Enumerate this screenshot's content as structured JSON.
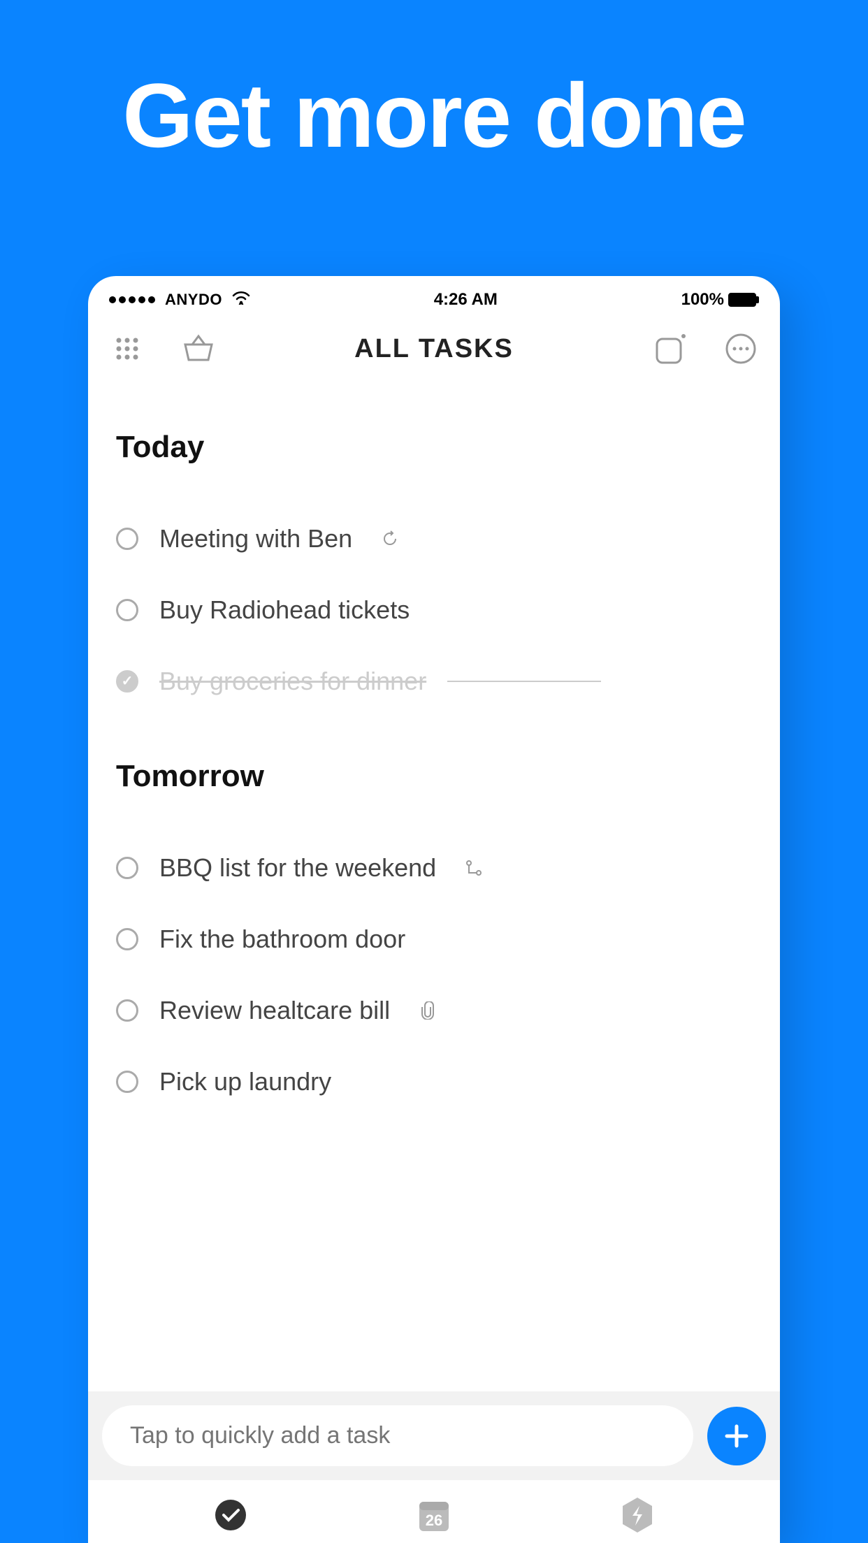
{
  "hero": "Get more done",
  "statusBar": {
    "carrier": "ANYDO",
    "time": "4:26 AM",
    "battery": "100%"
  },
  "nav": {
    "title": "ALL TASKS"
  },
  "sections": [
    {
      "title": "Today",
      "tasks": [
        {
          "label": "Meeting with Ben",
          "done": false,
          "indicator": "recurring"
        },
        {
          "label": "Buy Radiohead tickets",
          "done": false,
          "indicator": null
        },
        {
          "label": "Buy groceries for dinner",
          "done": true,
          "indicator": null
        }
      ]
    },
    {
      "title": "Tomorrow",
      "tasks": [
        {
          "label": "BBQ list for the weekend",
          "done": false,
          "indicator": "subtasks"
        },
        {
          "label": "Fix the bathroom door",
          "done": false,
          "indicator": null
        },
        {
          "label": "Review healtcare bill",
          "done": false,
          "indicator": "attachment"
        },
        {
          "label": "Pick up laundry",
          "done": false,
          "indicator": null
        }
      ]
    }
  ],
  "quickAdd": {
    "placeholder": "Tap to quickly add a task"
  },
  "tabBar": {
    "calendarDay": "26"
  }
}
